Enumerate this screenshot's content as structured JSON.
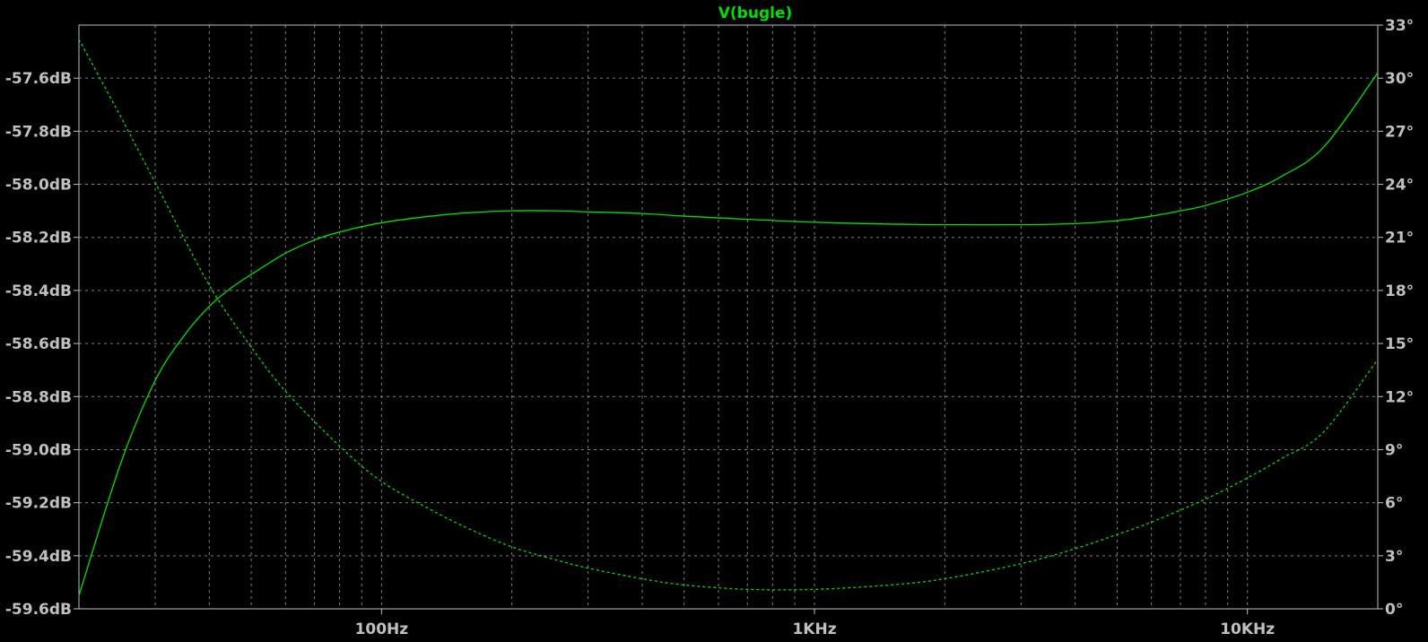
{
  "colors": {
    "background": "#000000",
    "axes": "#c0c0c0",
    "grid": "#808080",
    "trace": "#00e000",
    "labels": "#c0c0c0"
  },
  "chart_data": {
    "type": "line",
    "title": "V(bugle)",
    "x_scale": "log",
    "xlim": [
      20,
      20000
    ],
    "x_ticks": [
      {
        "value": 100,
        "label": "100Hz"
      },
      {
        "value": 1000,
        "label": "1KHz"
      },
      {
        "value": 10000,
        "label": "10KHz"
      }
    ],
    "y_left": {
      "unit": "dB",
      "lim": [
        -59.6,
        -57.4
      ],
      "ticks": [
        {
          "value": -57.6,
          "label": "-57.6dB"
        },
        {
          "value": -57.8,
          "label": "-57.8dB"
        },
        {
          "value": -58.0,
          "label": "-58.0dB"
        },
        {
          "value": -58.2,
          "label": "-58.2dB"
        },
        {
          "value": -58.4,
          "label": "-58.4dB"
        },
        {
          "value": -58.6,
          "label": "-58.6dB"
        },
        {
          "value": -58.8,
          "label": "-58.8dB"
        },
        {
          "value": -59.0,
          "label": "-59.0dB"
        },
        {
          "value": -59.2,
          "label": "-59.2dB"
        },
        {
          "value": -59.4,
          "label": "-59.4dB"
        },
        {
          "value": -59.6,
          "label": "-59.6dB"
        }
      ]
    },
    "y_right": {
      "unit": "degrees",
      "lim": [
        0,
        33
      ],
      "ticks": [
        {
          "value": 33,
          "label": "33°"
        },
        {
          "value": 30,
          "label": "30°"
        },
        {
          "value": 27,
          "label": "27°"
        },
        {
          "value": 24,
          "label": "24°"
        },
        {
          "value": 21,
          "label": "21°"
        },
        {
          "value": 18,
          "label": "18°"
        },
        {
          "value": 15,
          "label": "15°"
        },
        {
          "value": 12,
          "label": "12°"
        },
        {
          "value": 9,
          "label": "9°"
        },
        {
          "value": 6,
          "label": "6°"
        },
        {
          "value": 3,
          "label": "3°"
        },
        {
          "value": 0,
          "label": "0°"
        }
      ]
    },
    "grid": true,
    "series": [
      {
        "axis": "left",
        "style": "solid",
        "x": [
          20,
          25,
          30,
          35,
          40,
          45,
          50,
          60,
          70,
          80,
          100,
          130,
          160,
          200,
          250,
          300,
          400,
          500,
          700,
          1000,
          1500,
          2000,
          3000,
          4000,
          5000,
          6000,
          7000,
          8000,
          10000,
          12000,
          15000,
          20000
        ],
        "y": [
          -59.55,
          -59.05,
          -58.74,
          -58.57,
          -58.46,
          -58.39,
          -58.34,
          -58.26,
          -58.21,
          -58.18,
          -58.145,
          -58.12,
          -58.107,
          -58.1,
          -58.1,
          -58.104,
          -58.11,
          -58.12,
          -58.132,
          -58.143,
          -58.15,
          -58.152,
          -58.152,
          -58.148,
          -58.137,
          -58.12,
          -58.1,
          -58.08,
          -58.03,
          -57.97,
          -57.86,
          -57.58
        ]
      },
      {
        "axis": "right",
        "style": "dashed",
        "x": [
          20,
          25,
          30,
          40,
          50,
          60,
          80,
          100,
          130,
          160,
          200,
          250,
          300,
          400,
          500,
          700,
          1000,
          1500,
          2000,
          3000,
          4000,
          5000,
          6000,
          8000,
          10000,
          12000,
          15000,
          20000
        ],
        "y": [
          32.2,
          27.8,
          24.1,
          18.3,
          14.8,
          12.3,
          9.2,
          7.2,
          5.6,
          4.5,
          3.5,
          2.8,
          2.3,
          1.7,
          1.35,
          1.1,
          1.1,
          1.35,
          1.7,
          2.55,
          3.4,
          4.2,
          4.9,
          6.2,
          7.4,
          8.5,
          10.0,
          14.1
        ]
      }
    ]
  }
}
